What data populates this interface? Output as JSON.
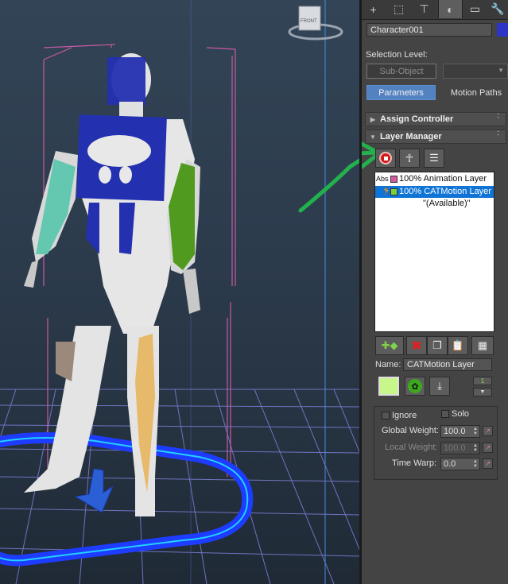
{
  "viewport": {
    "viewcube_label": "FRONT"
  },
  "command_panel": {
    "tabs": [
      {
        "icon": "create-plus-icon",
        "glyph": "+"
      },
      {
        "icon": "modify-icon",
        "glyph": "⬚"
      },
      {
        "icon": "hierarchy-icon",
        "glyph": "⊤"
      },
      {
        "icon": "motion-icon",
        "glyph": "◐"
      },
      {
        "icon": "display-icon",
        "glyph": "▭"
      },
      {
        "icon": "utilities-wrench-icon",
        "glyph": "🔧"
      }
    ],
    "active_tab": "motion",
    "object_name": "Character001",
    "object_color": "#2d34c8",
    "selection_level_label": "Selection Level:",
    "sub_object_label": "Sub-Object",
    "parameters_label": "Parameters",
    "motion_paths_label": "Motion Paths",
    "assign_controller_label": "Assign Controller",
    "layer_manager_label": "Layer Manager",
    "layers": [
      {
        "prefix": "Abs",
        "weight_label": "100% Animation Layer",
        "color": "#d45aa0",
        "selected": false
      },
      {
        "prefix": "",
        "weight_label": "100% CATMotion Layer",
        "color": "#7cd23c",
        "selected": true
      }
    ],
    "available_label": "\"(Available)\"",
    "name_label": "Name:",
    "name_value": "CATMotion Layer",
    "layer_color": "#c7f78a",
    "ignore_label": "Ignore",
    "solo_label": "Solo",
    "global_weight_label": "Global Weight:",
    "global_weight_value": "100.0",
    "local_weight_label": "Local Weight:",
    "local_weight_value": "100.0",
    "time_warp_label": "Time Warp:",
    "time_warp_value": "0.0",
    "layer_index": "1"
  }
}
